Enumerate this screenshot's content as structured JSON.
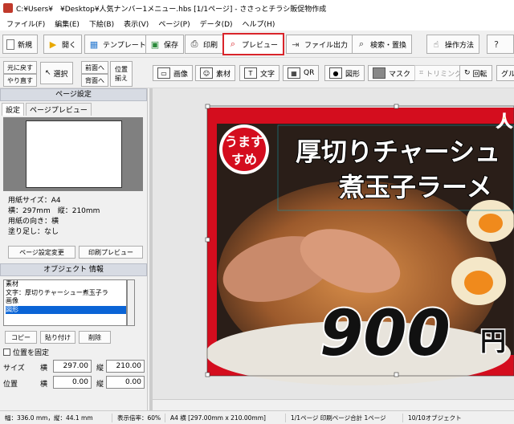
{
  "title": "C:¥Users¥　¥Desktop¥人気ナンバー1メニュー.hbs [1/1ページ] - ささっとチラシ販促物作成",
  "menu": [
    "ファイル(F)",
    "編集(E)",
    "下絵(B)",
    "表示(V)",
    "ページ(P)",
    "データ(D)",
    "ヘルプ(H)"
  ],
  "toolbar": {
    "new": "新規",
    "open": "開く",
    "template": "テンプレート",
    "save": "保存",
    "print": "印刷",
    "preview": "プレビュー",
    "file_output": "ファイル出力",
    "search_replace": "検索・置換",
    "how_to": "操作方法"
  },
  "toolbar2": {
    "restore": "元に戻す",
    "redo": "やり直す",
    "select": "選択",
    "front": "前面へ",
    "back": "背面へ",
    "align": "位置",
    "align2": "揃え",
    "image": "画像",
    "material": "素材",
    "text": "文字",
    "qr": "QR",
    "shape": "図形",
    "mask": "マスク",
    "trimming": "トリミング",
    "rotate": "回転",
    "group": "グル"
  },
  "page_settings": {
    "header": "ページ設定",
    "tab_settings": "設定",
    "tab_preview": "ページプレビュー",
    "paper_size": "用紙サイズ：A4",
    "dimensions": "横：297mm　縦：210mm",
    "orientation": "用紙の向き：横",
    "bleed": "塗り足し：なし",
    "change_button": "ページ設定変更",
    "print_preview_button": "印刷プレビュー"
  },
  "object_info": {
    "header": "オブジェクト 情報",
    "items": [
      "素材",
      "文字：厚切りチャーシュー煮玉子ラ",
      "画像",
      "図形"
    ],
    "selected_index": 3,
    "copy": "コピー",
    "paste": "貼り付け",
    "delete": "削除",
    "fix_position": "位置を固定",
    "size_label": "サイズ",
    "width_label": "横",
    "height_label": "縦",
    "position_label": "位置",
    "width": "297.00",
    "height": "210.00",
    "pos_x": "0.00",
    "pos_y": "0.00"
  },
  "flyer": {
    "badge_line1": "うます",
    "badge_line2": "すめ",
    "title1": "厚切りチャーシュ",
    "title2": "煮玉子ラーメ",
    "price": "900",
    "yen": "円",
    "corner_tag": "人"
  },
  "status": {
    "size": "幅：336.0 mm，縦：44.1 mm",
    "zoom": "表示倍率：60%",
    "paper": "A4 横 [297.00mm x 210.00mm]",
    "pages": "1/1ページ 印刷ページ合計 1ページ",
    "objects": "10/10オブジェクト"
  },
  "colors": {
    "highlight": "#d9242a",
    "flyer_red": "#d40d1e",
    "selection": "#0a64d6"
  }
}
